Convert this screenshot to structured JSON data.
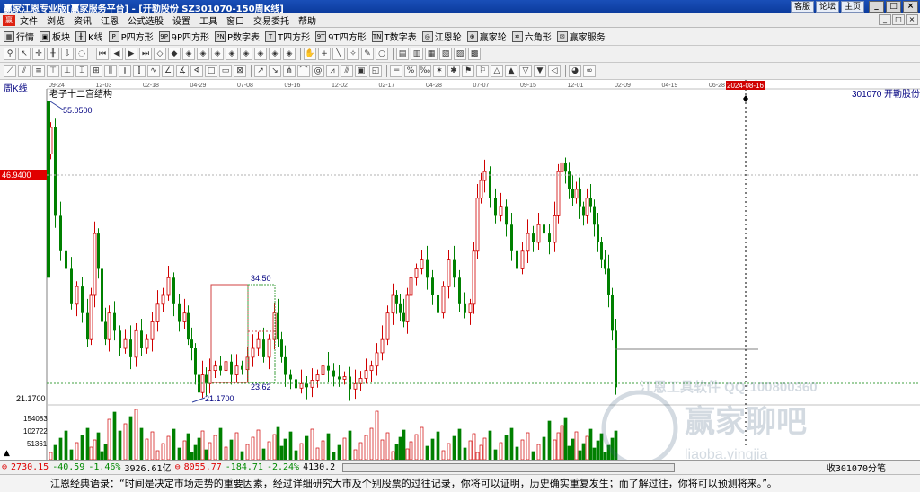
{
  "window": {
    "title": "赢家江恩专业版[赢家服务平台] - [开勒股份  SZ301070-150周K线]",
    "links": [
      "客服",
      "论坛",
      "主页"
    ],
    "controls": [
      "_",
      "□",
      "×"
    ]
  },
  "menu": {
    "logo": "赢",
    "items": [
      "文件",
      "浏览",
      "资讯",
      "江恩",
      "公式选股",
      "设置",
      "工具",
      "窗口",
      "交易委托",
      "帮助"
    ]
  },
  "toolbar1": {
    "items": [
      {
        "icon": "grid-icon",
        "glyph": "▦",
        "label": "行情"
      },
      {
        "icon": "block-icon",
        "glyph": "▣",
        "label": "板块"
      },
      {
        "icon": "kline-icon",
        "glyph": "╫",
        "label": "K线"
      },
      {
        "icon": "p-square-icon",
        "glyph": "P",
        "label": "P四方形"
      },
      {
        "icon": "9p-square-icon",
        "glyph": "9P",
        "label": "9P四方形"
      },
      {
        "icon": "pn-table-icon",
        "glyph": "PN",
        "label": "P数字表"
      },
      {
        "icon": "t-square-icon",
        "glyph": "T",
        "label": "T四方形"
      },
      {
        "icon": "9t-square-icon",
        "glyph": "9T",
        "label": "9T四方形"
      },
      {
        "icon": "tn-table-icon",
        "glyph": "TN",
        "label": "T数字表"
      },
      {
        "icon": "gann-wheel-icon",
        "glyph": "◎",
        "label": "江恩轮"
      },
      {
        "icon": "winner-wheel-icon",
        "glyph": "⊕",
        "label": "赢家轮"
      },
      {
        "icon": "hexagon-icon",
        "glyph": "✡",
        "label": "六角形"
      },
      {
        "icon": "service-icon",
        "glyph": "✉",
        "label": "赢家服务"
      }
    ]
  },
  "chart": {
    "period_label": "周K线",
    "structure_label": "老子十二宫结构",
    "stock_code": "301070",
    "stock_name": "开勒股份",
    "axis_price_marker": "46.9400",
    "axis_low_label": "21.1700",
    "volume_labels": [
      "154083",
      "102722",
      "51361"
    ],
    "date_ticks": [
      "09-24",
      "12-03",
      "02-18",
      "04-29",
      "07-08",
      "09-16",
      "12-02",
      "02-17",
      "04-28",
      "07-07",
      "09-15",
      "12-01",
      "02-09",
      "04-19",
      "06-28"
    ],
    "cursor_date": "2024-08-16",
    "annotations": {
      "high": "55.0500",
      "low": "21.1700",
      "box_high": "34.50",
      "box_low": "23.62"
    },
    "watermark_line1": "江恩工具软件   QQ:100800360",
    "watermark_line2": "赢家聊吧",
    "watermark_line3": "liaoba.yingjia",
    "colors": {
      "up": "#d00000",
      "down": "#008000",
      "axis": "#808080",
      "label": "#000080",
      "marker_bg": "#e00000"
    }
  },
  "status": {
    "sh_index": "2730.15",
    "sh_change": "-40.59",
    "sh_pct": "-1.46%",
    "sh_amount": "3926.61亿",
    "sz_index": "8055.77",
    "sz_change": "-184.71",
    "sz_pct": "-2.24%",
    "sz_amount": "4130.2",
    "right_text": "收301070分笔"
  },
  "quote": "江恩经典语录：“时间是决定市场走势的重要因素，经过详细研究大市及个别股票的过往记录，你将可以证明，历史确实重复发生；而了解过往，你将可以预测将来。”。"
}
